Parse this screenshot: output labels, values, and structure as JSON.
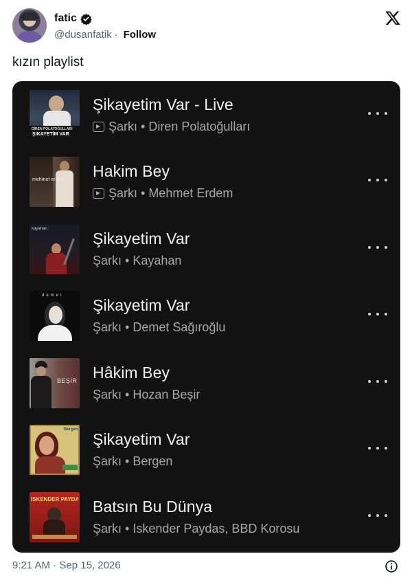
{
  "user": {
    "display_name": "fatic",
    "handle": "@dusanfatik",
    "follow_label": "Follow",
    "separator": "·"
  },
  "tweet": {
    "text": "kızın playlist",
    "timestamp": "9:21 AM · Sep 15, 2026"
  },
  "playlist": [
    {
      "title": "Şikayetim Var - Live",
      "subtitle": "Şarkı • Diren Polatoğulları",
      "video_icon": true,
      "cover_label": "ŞİKAYETİM VAR",
      "cover_top": "DİREN POLATOĞULLARI"
    },
    {
      "title": "Hakim Bey",
      "subtitle": "Şarkı • Mehmet Erdem",
      "video_icon": true,
      "cover_label": "mehmet erdem"
    },
    {
      "title": "Şikayetim Var",
      "subtitle": "Şarkı • Kayahan",
      "video_icon": false,
      "cover_label": "kayahan"
    },
    {
      "title": "Şikayetim Var",
      "subtitle": "Şarkı • Demet Sağıroğlu",
      "video_icon": false,
      "cover_label": "demet"
    },
    {
      "title": "Hâkim Bey",
      "subtitle": "Şarkı • Hozan Beşir",
      "video_icon": false,
      "cover_label": "BEŞİR"
    },
    {
      "title": "Şikayetim Var",
      "subtitle": "Şarkı • Bergen",
      "video_icon": false,
      "cover_label": "Bergen"
    },
    {
      "title": "Batsın Bu Dünya",
      "subtitle": "Şarkı • Iskender Paydas, BBD Korosu",
      "video_icon": false,
      "cover_label": "ISKENDER PAYDAŞ"
    }
  ],
  "icons": {
    "verified": "verified-badge-icon",
    "x_logo": "x-logo-icon",
    "more": "more-options-icon",
    "info": "info-icon"
  },
  "colors": {
    "card_bg": "#121212",
    "title": "#f1f1f1",
    "subtitle": "#a7a7a7",
    "muted_text": "#536471"
  }
}
